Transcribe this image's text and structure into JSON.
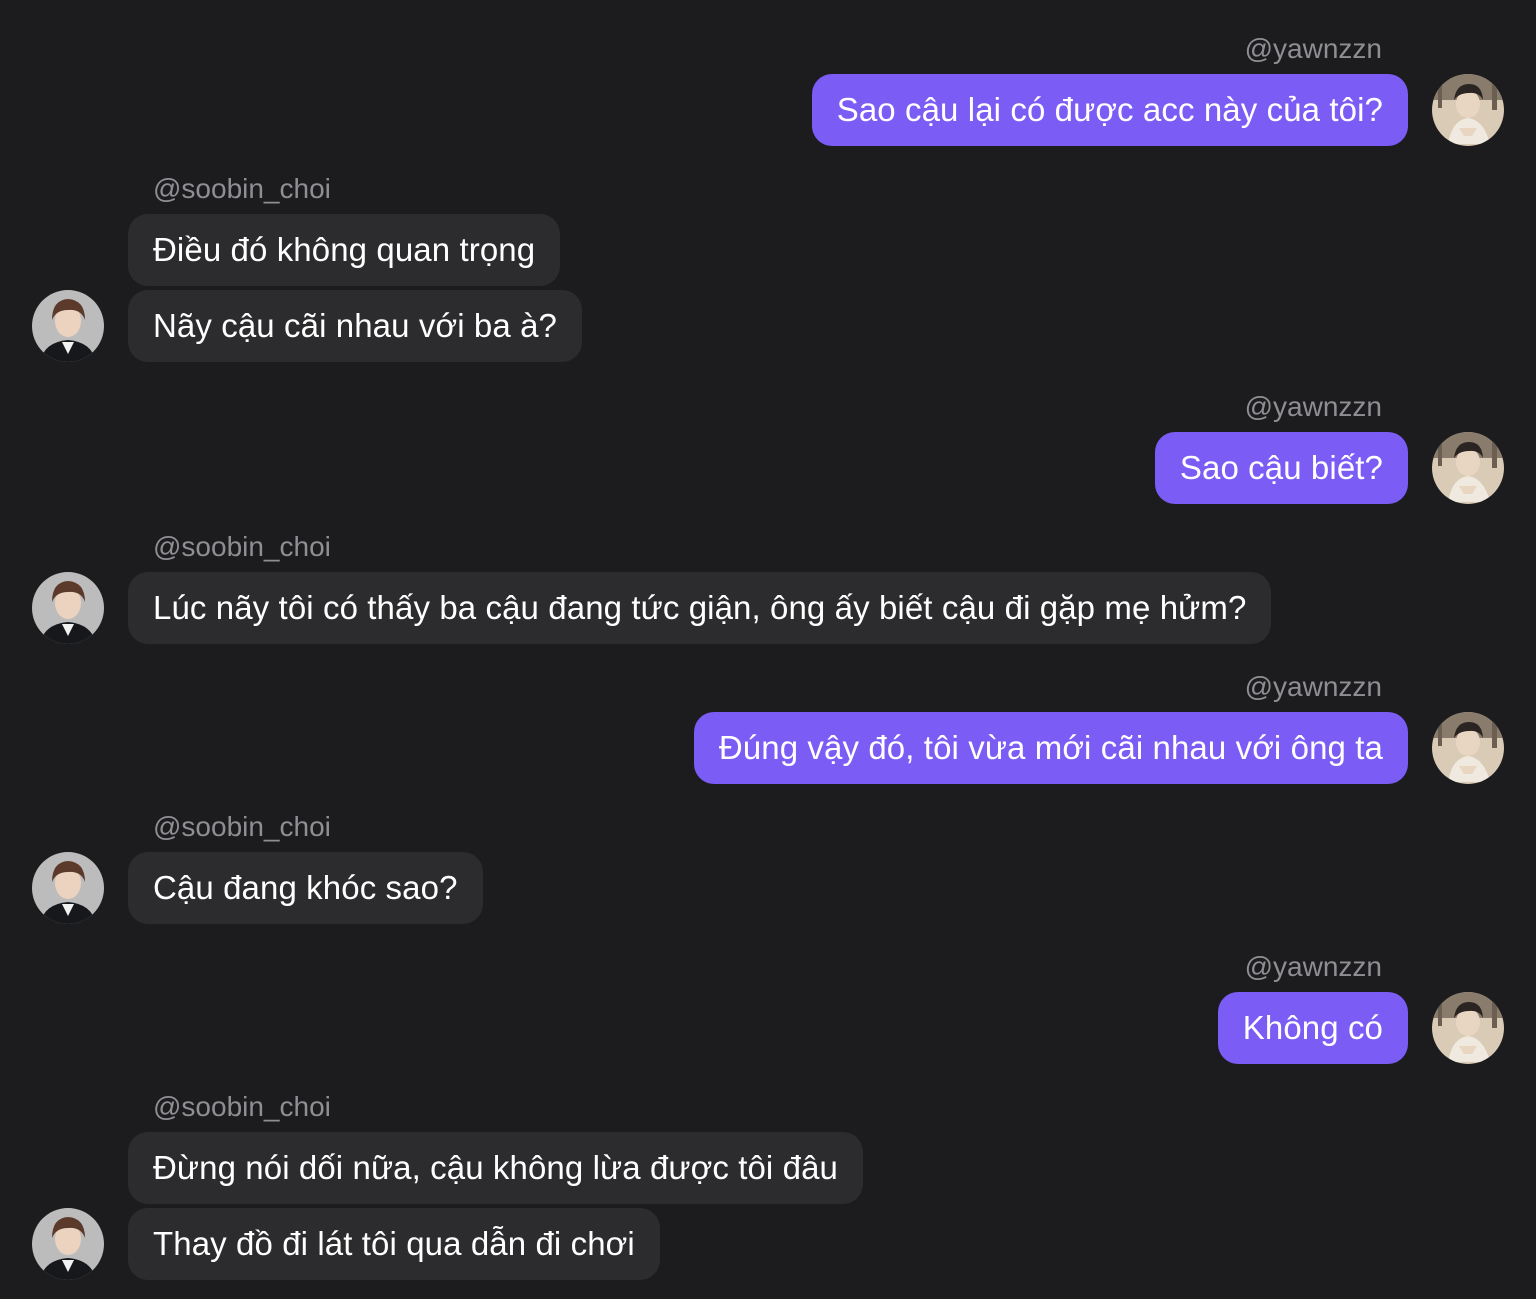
{
  "conversation": {
    "messages": [
      {
        "sender": "@yawnzzn",
        "side": "right",
        "texts": [
          "Sao cậu lại có được acc này của tôi?"
        ]
      },
      {
        "sender": "@soobin_choi",
        "side": "left",
        "texts": [
          "Điều đó không quan trọng",
          "Nãy cậu cãi nhau với ba à?"
        ]
      },
      {
        "sender": "@yawnzzn",
        "side": "right",
        "texts": [
          "Sao cậu biết?"
        ]
      },
      {
        "sender": "@soobin_choi",
        "side": "left",
        "texts": [
          "Lúc nãy tôi có thấy ba cậu đang tức giận, ông ấy biết cậu đi gặp mẹ hửm?"
        ]
      },
      {
        "sender": "@yawnzzn",
        "side": "right",
        "texts": [
          "Đúng vậy đó, tôi vừa mới cãi nhau với ông ta"
        ]
      },
      {
        "sender": "@soobin_choi",
        "side": "left",
        "texts": [
          "Cậu đang khóc sao?"
        ]
      },
      {
        "sender": "@yawnzzn",
        "side": "right",
        "texts": [
          "Không có"
        ]
      },
      {
        "sender": "@soobin_choi",
        "side": "left",
        "texts": [
          "Đừng nói dối nữa, cậu không lừa được tôi đâu",
          "Thay đồ đi lát tôi qua dẫn đi chơi"
        ]
      }
    ]
  },
  "colors": {
    "background": "#1c1c1e",
    "outgoing_bubble": "#7b5cf5",
    "incoming_bubble": "#2c2c2e",
    "username": "#8e8e93",
    "text": "#ffffff"
  },
  "icons": {
    "yawnzzn_avatar": "avatar-photo",
    "soobin_avatar": "avatar-photo"
  }
}
